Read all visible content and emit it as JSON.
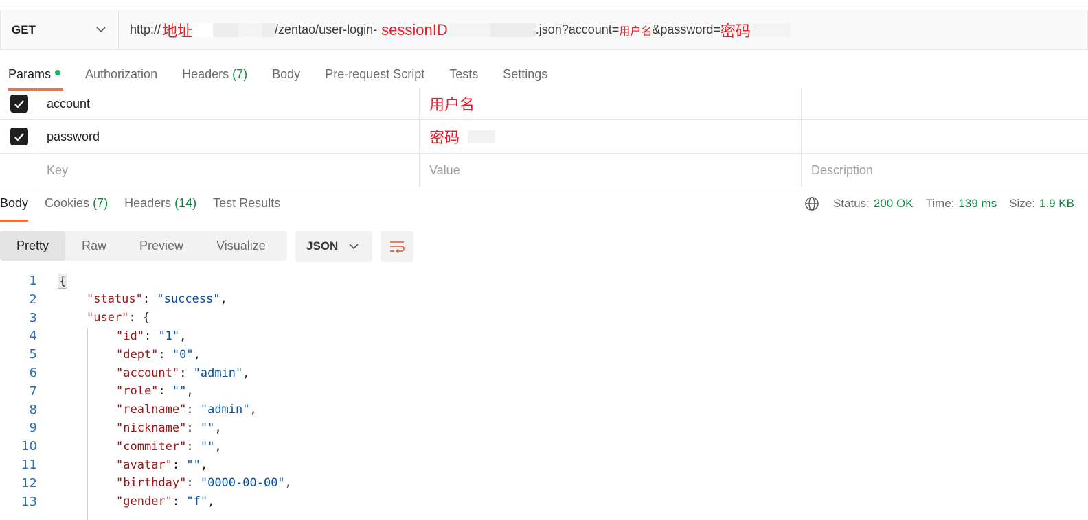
{
  "request": {
    "method": "GET",
    "url": {
      "prefix": "http://",
      "address_note": "地址",
      "path": "/zentao/user-login-",
      "session_note": "sessionID",
      "suffix": ".json?account=",
      "account_note": "用户名",
      "password_param": "&password=",
      "password_note": "密码"
    }
  },
  "request_tabs": [
    {
      "label": "Params",
      "active": true
    },
    {
      "label": "Authorization"
    },
    {
      "label": "Headers",
      "count": "(7)"
    },
    {
      "label": "Body"
    },
    {
      "label": "Pre-request Script"
    },
    {
      "label": "Tests"
    },
    {
      "label": "Settings"
    }
  ],
  "params": {
    "rows": [
      {
        "key": "account",
        "value": "用户名",
        "checked": true
      },
      {
        "key": "password",
        "value": "密码",
        "checked": true
      }
    ],
    "placeholders": {
      "key": "Key",
      "value": "Value",
      "description": "Description"
    }
  },
  "response_tabs": [
    {
      "label": "Body",
      "active": true
    },
    {
      "label": "Cookies",
      "count": "(7)"
    },
    {
      "label": "Headers",
      "count": "(14)"
    },
    {
      "label": "Test Results"
    }
  ],
  "response_status": {
    "status_label": "Status:",
    "status_value": "200 OK",
    "time_label": "Time:",
    "time_value": "139 ms",
    "size_label": "Size:",
    "size_value": "1.9 KB"
  },
  "view_modes": [
    "Pretty",
    "Raw",
    "Preview",
    "Visualize"
  ],
  "active_view": "Pretty",
  "format": "JSON",
  "code_lines": [
    {
      "n": "1",
      "indent": 0,
      "open": "{"
    },
    {
      "n": "2",
      "indent": 1,
      "key": "\"status\"",
      "sep": ": ",
      "str": "\"success\"",
      "tail": ","
    },
    {
      "n": "3",
      "indent": 1,
      "key": "\"user\"",
      "sep": ": ",
      "tail": "{"
    },
    {
      "n": "4",
      "indent": 2,
      "key": "\"id\"",
      "sep": ": ",
      "str": "\"1\"",
      "tail": ","
    },
    {
      "n": "5",
      "indent": 2,
      "key": "\"dept\"",
      "sep": ": ",
      "str": "\"0\"",
      "tail": ","
    },
    {
      "n": "6",
      "indent": 2,
      "key": "\"account\"",
      "sep": ": ",
      "str": "\"admin\"",
      "tail": ","
    },
    {
      "n": "7",
      "indent": 2,
      "key": "\"role\"",
      "sep": ": ",
      "str": "\"\"",
      "tail": ","
    },
    {
      "n": "8",
      "indent": 2,
      "key": "\"realname\"",
      "sep": ": ",
      "str": "\"admin\"",
      "tail": ","
    },
    {
      "n": "9",
      "indent": 2,
      "key": "\"nickname\"",
      "sep": ": ",
      "str": "\"\"",
      "tail": ","
    },
    {
      "n": "10",
      "indent": 2,
      "key": "\"commiter\"",
      "sep": ": ",
      "str": "\"\"",
      "tail": ","
    },
    {
      "n": "11",
      "indent": 2,
      "key": "\"avatar\"",
      "sep": ": ",
      "str": "\"\"",
      "tail": ","
    },
    {
      "n": "12",
      "indent": 2,
      "key": "\"birthday\"",
      "sep": ": ",
      "str": "\"0000-00-00\"",
      "tail": ","
    },
    {
      "n": "13",
      "indent": 2,
      "key": "\"gender\"",
      "sep": ": ",
      "str": "\"f\"",
      "tail": ","
    }
  ]
}
